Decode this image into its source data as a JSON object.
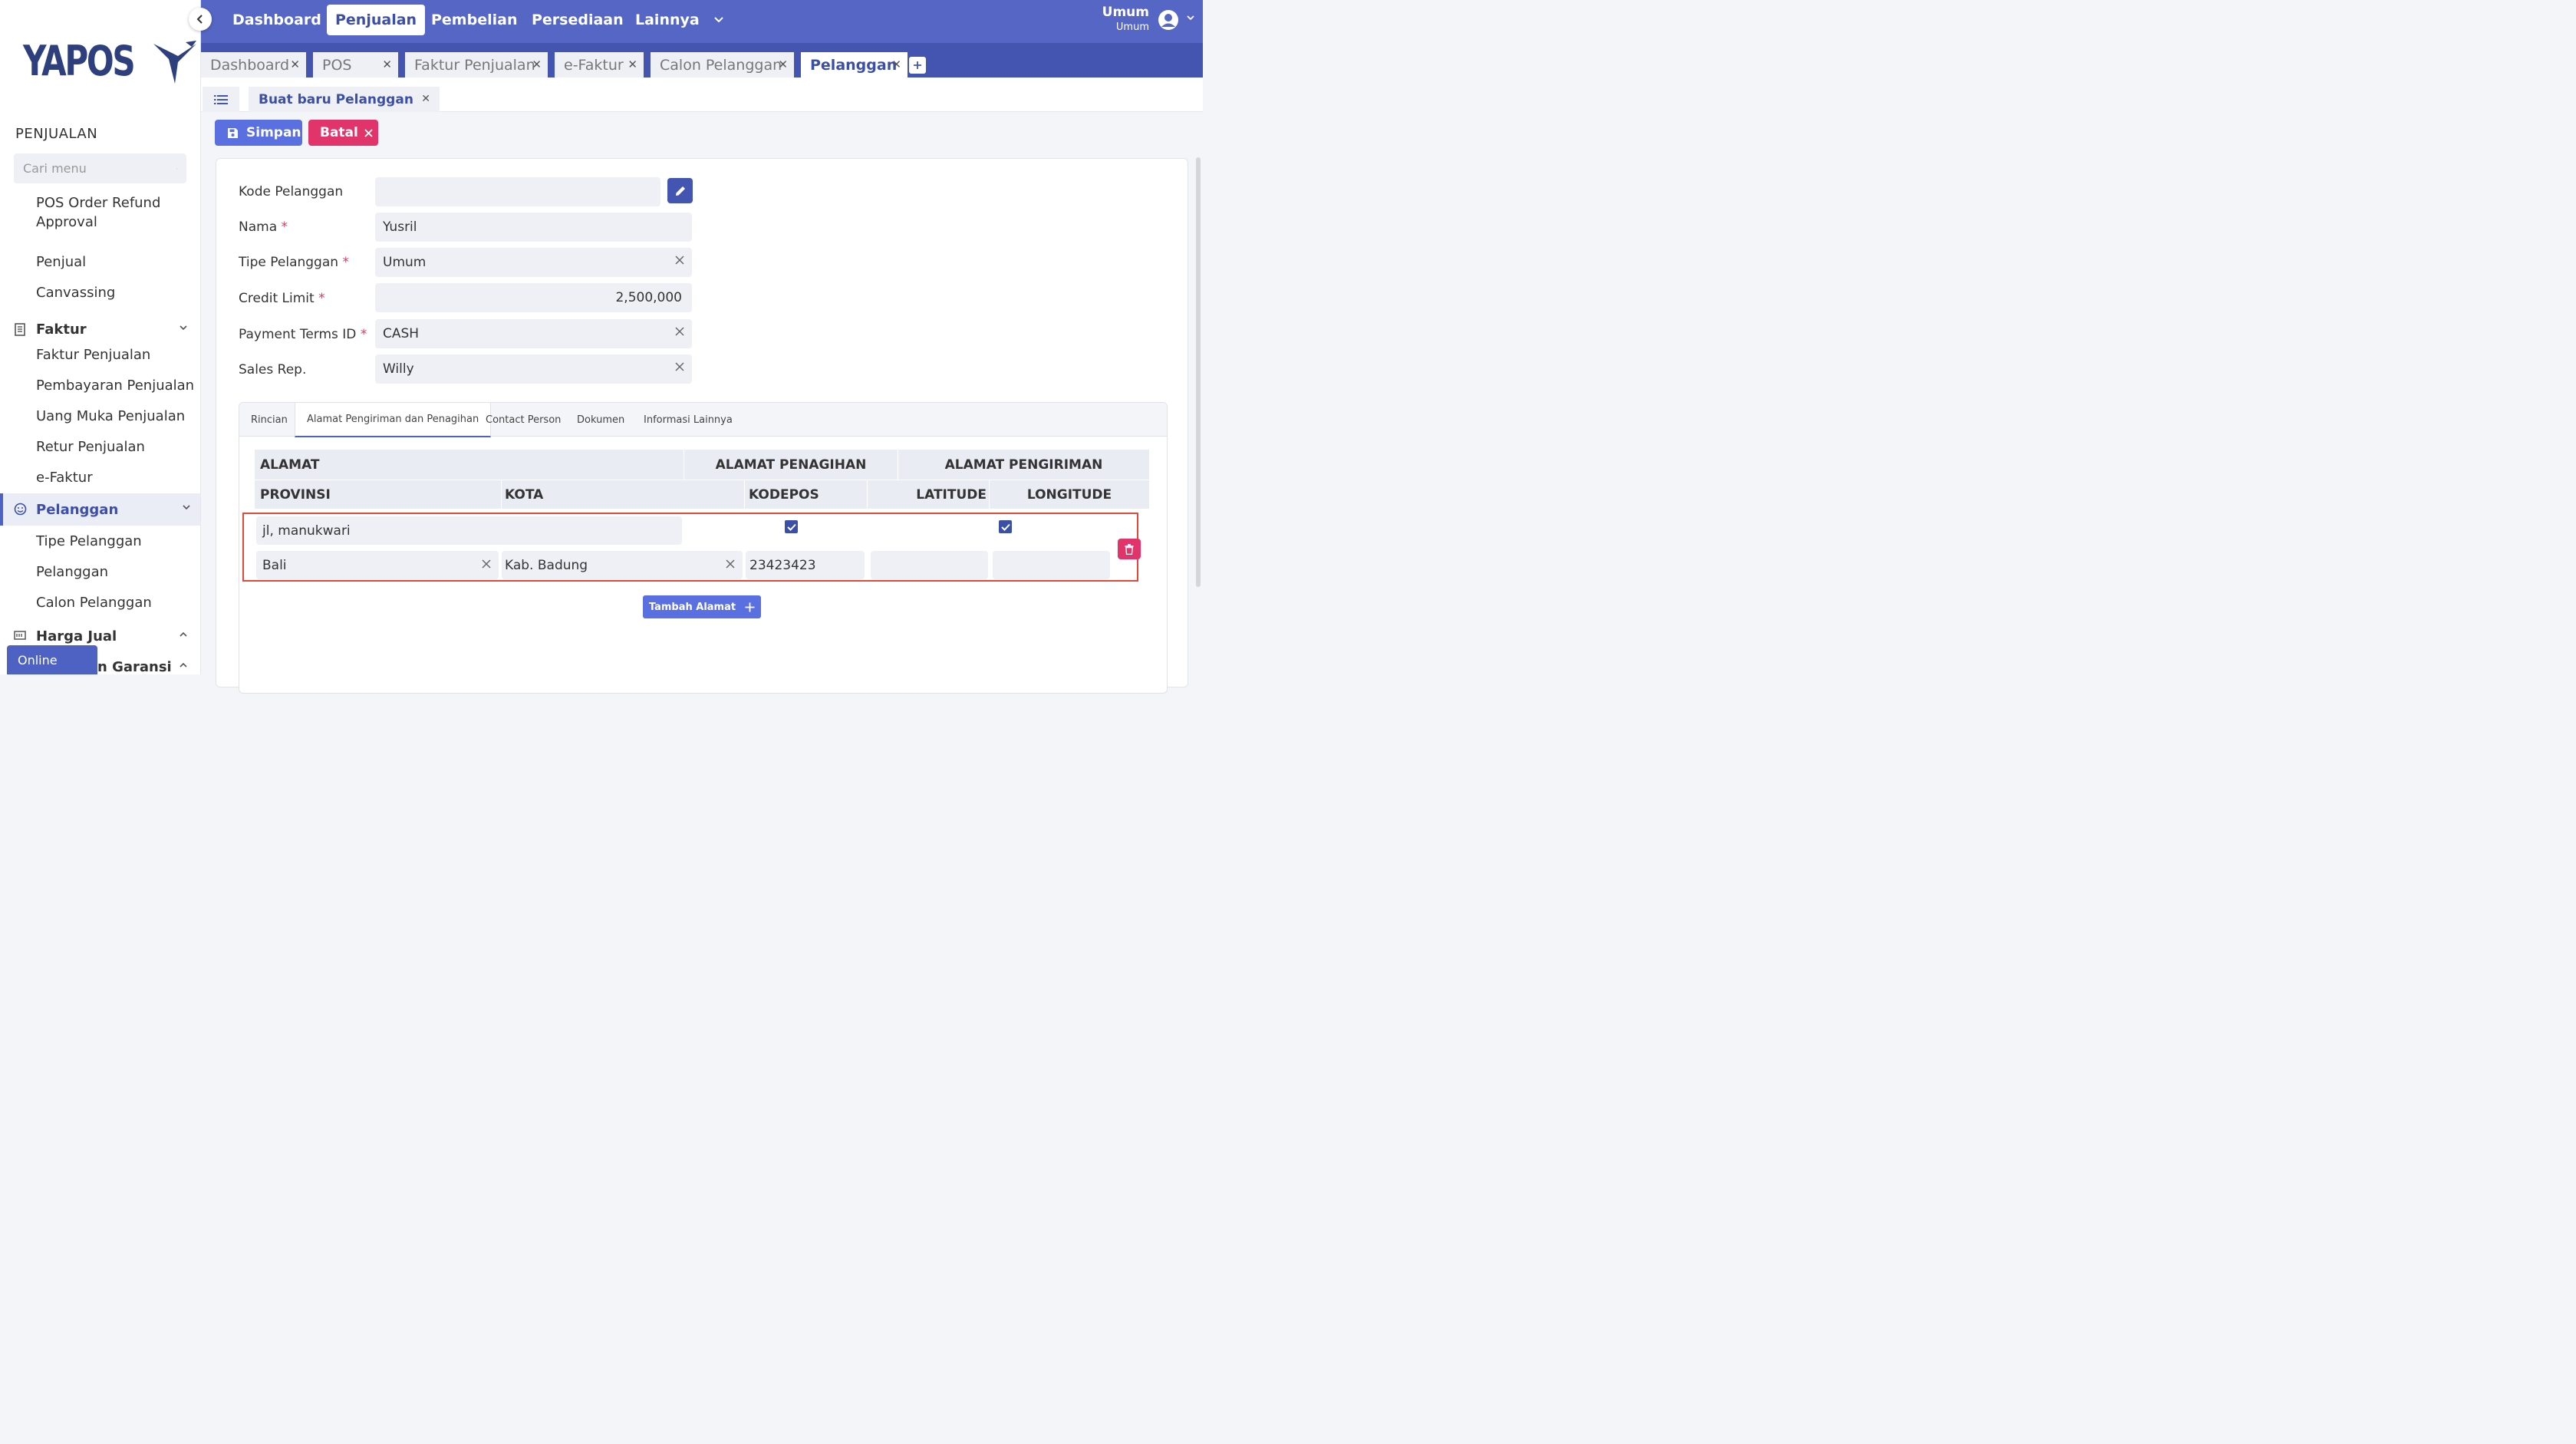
{
  "brand": {
    "name": "YAPOS",
    "primary": "#5566c4",
    "dark": "#4354b1",
    "accent_red": "#e0346b"
  },
  "sidebar": {
    "section_title": "PENJUALAN",
    "search_placeholder": "Cari menu",
    "items": [
      {
        "label": "POS Order Refund Approval"
      },
      {
        "label": "Penjual"
      },
      {
        "label": "Canvassing"
      },
      {
        "label": "Faktur",
        "group": true,
        "icon": "invoice-icon",
        "expanded": true
      },
      {
        "label": "Faktur Penjualan"
      },
      {
        "label": "Pembayaran Penjualan"
      },
      {
        "label": "Uang Muka Penjualan"
      },
      {
        "label": "Retur Penjualan"
      },
      {
        "label": "e-Faktur"
      },
      {
        "label": "Pelanggan",
        "group": true,
        "icon": "customer-icon",
        "expanded": true,
        "active": true
      },
      {
        "label": "Tipe Pelanggan"
      },
      {
        "label": "Pelanggan"
      },
      {
        "label": "Calon Pelanggan"
      },
      {
        "label": "Harga Jual",
        "group": true,
        "icon": "price-icon",
        "expanded": false
      },
      {
        "label": "n Garansi",
        "group": true,
        "icon": "warranty-icon",
        "expanded": false
      }
    ],
    "online_label": "Online"
  },
  "topnav": {
    "items": [
      "Dashboard",
      "Penjualan",
      "Pembelian",
      "Persediaan",
      "Lainnya"
    ],
    "active": "Penjualan",
    "user_name": "Umum",
    "user_sub": "Umum"
  },
  "tabs": [
    "Dashboard",
    "POS",
    "Faktur Penjualan",
    "e-Faktur",
    "Calon Pelanggan",
    "Pelanggan"
  ],
  "active_tab": "Pelanggan",
  "subtab": {
    "label": "Buat baru Pelanggan"
  },
  "actions": {
    "save": "Simpan",
    "cancel": "Batal"
  },
  "form": {
    "kode_label": "Kode Pelanggan",
    "kode_value": "",
    "nama_label": "Nama",
    "nama_value": "Yusril",
    "tipe_label": "Tipe Pelanggan",
    "tipe_value": "Umum",
    "credit_label": "Credit Limit",
    "credit_value": "2,500,000",
    "payment_label": "Payment Terms ID",
    "payment_value": "CASH",
    "sales_label": "Sales Rep.",
    "sales_value": "Willy",
    "required_mark": "*"
  },
  "detail_tabs": [
    "Rincian",
    "Alamat Pengiriman dan Penagihan",
    "Contact Person",
    "Dokumen",
    "Informasi Lainnya"
  ],
  "active_detail_tab": "Alamat Pengiriman dan Penagihan",
  "address_table": {
    "head1": {
      "alamat": "ALAMAT",
      "penagihan": "ALAMAT PENAGIHAN",
      "pengiriman": "ALAMAT PENGIRIMAN"
    },
    "head2": {
      "provinsi": "PROVINSI",
      "kota": "KOTA",
      "kodepos": "KODEPOS",
      "latitude": "LATITUDE",
      "longitude": "LONGITUDE"
    },
    "rows": [
      {
        "alamat": "jl, manukwari",
        "penagihan_checked": true,
        "pengiriman_checked": true,
        "provinsi": "Bali",
        "kota": "Kab. Badung",
        "kodepos": "23423423",
        "latitude": "",
        "longitude": ""
      }
    ],
    "add_label": "Tambah Alamat"
  }
}
